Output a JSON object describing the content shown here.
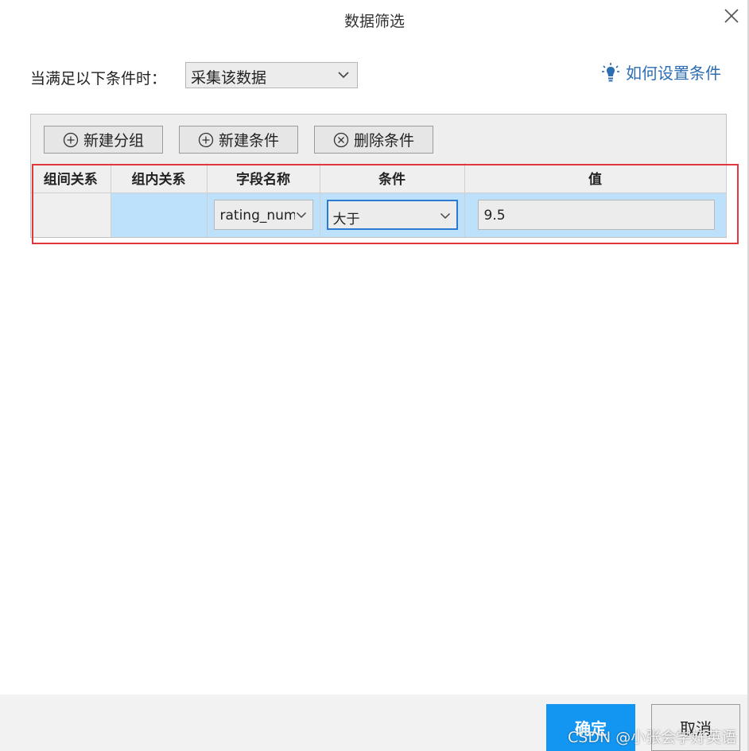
{
  "dialog": {
    "title": "数据筛选",
    "condition_label": "当满足以下条件时：",
    "mode_select_value": "采集该数据",
    "help_link_label": "如何设置条件"
  },
  "toolbar": {
    "new_group_label": "新建分组",
    "new_condition_label": "新建条件",
    "delete_condition_label": "删除条件"
  },
  "table": {
    "headers": [
      "组间关系",
      "组内关系",
      "字段名称",
      "条件",
      "值"
    ],
    "rows": [
      {
        "group_relation": "",
        "inner_relation": "",
        "field_name": "rating_num",
        "condition": "大于",
        "value": "9.5"
      }
    ]
  },
  "footer": {
    "ok_label": "确定",
    "cancel_label": "取消"
  },
  "watermark": "CSDN @小张会学好英语",
  "colors": {
    "accent": "#1296f2",
    "link": "#2d6db2",
    "selected_row": "#bde0fb",
    "highlight_border": "#e1373d"
  },
  "icons": [
    "close-icon",
    "lightbulb-icon",
    "chevron-down-icon",
    "plus-circle-icon",
    "x-circle-icon"
  ]
}
